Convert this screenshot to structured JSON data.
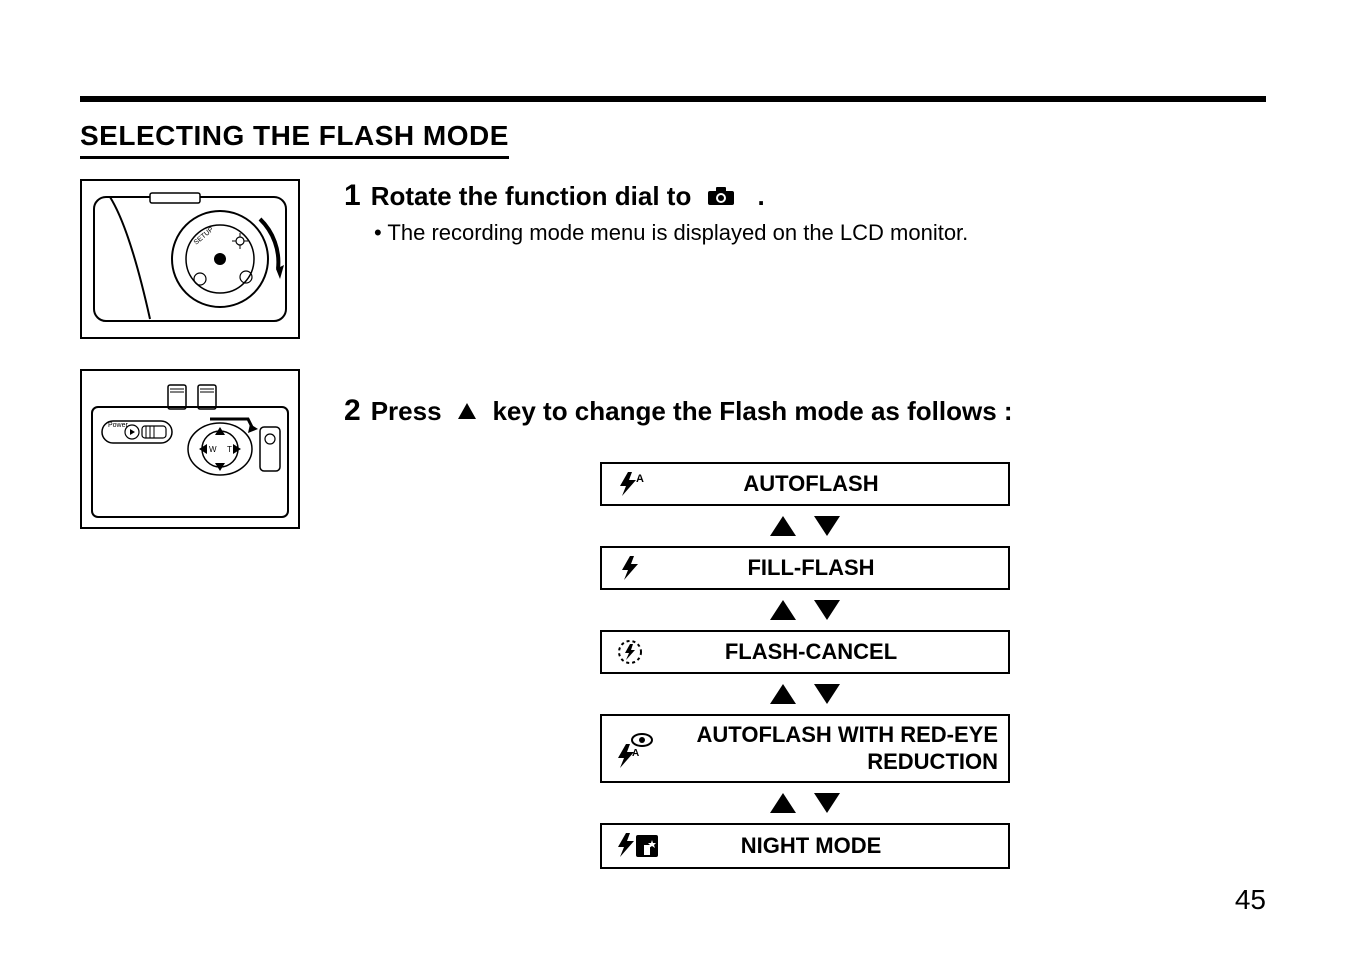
{
  "section_title": "SELECTING THE FLASH MODE",
  "step1": {
    "num": "1",
    "text_before": "Rotate the function dial to",
    "text_after": ".",
    "substep": "• The recording mode menu is displayed on the LCD monitor."
  },
  "step2": {
    "num": "2",
    "text_before": "Press",
    "text_after": "key to change the Flash mode as follows :"
  },
  "modes": {
    "autoflash": "AUTOFLASH",
    "fill_flash": "FILL-FLASH",
    "flash_cancel": "FLASH-CANCEL",
    "autoflash_red_l1": "AUTOFLASH WITH RED-EYE",
    "autoflash_red_l2": "REDUCTION",
    "night_mode": "NIGHT MODE"
  },
  "page_number": "45"
}
